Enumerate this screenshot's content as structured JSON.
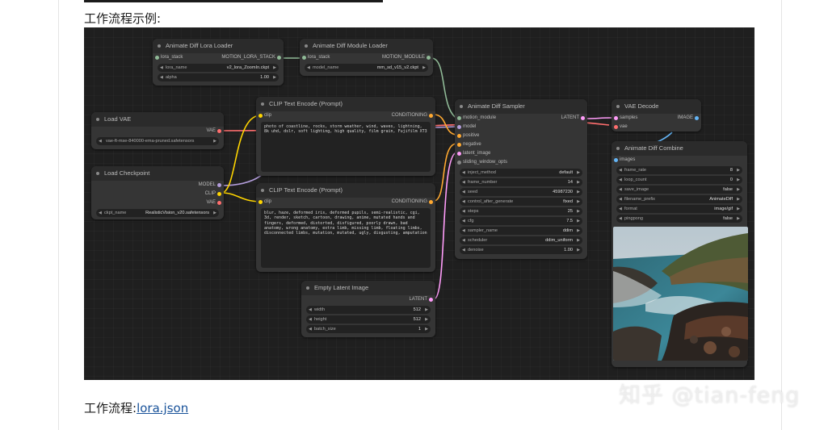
{
  "article": {
    "heading": "工作流程示例:",
    "footer_label": "工作流程:",
    "footer_link": "lora.json",
    "watermark": "知乎 @tian-feng"
  },
  "colors": {
    "model": "#b39ddb",
    "clip": "#ffd500",
    "vae": "#ff6e6e",
    "conditioning": "#ffa931",
    "latent": "#ff9cf9",
    "image": "#64b5f6",
    "motion": "#8fb996"
  },
  "nodes": {
    "lora_loader": {
      "title": "Animate Diff Lora Loader",
      "input_label": "lora_stack",
      "output_label": "MOTION_LORA_STACK",
      "widgets": [
        {
          "label": "lora_name",
          "value": "v2_lora_ZoomIn.ckpt"
        },
        {
          "label": "alpha",
          "value": "1.00"
        }
      ]
    },
    "module_loader": {
      "title": "Animate Diff Module Loader",
      "input_label": "lora_stack",
      "output_label": "MOTION_MODULE",
      "widgets": [
        {
          "label": "model_name",
          "value": "mm_sd_v15_v2.ckpt"
        }
      ]
    },
    "load_vae": {
      "title": "Load VAE",
      "output_label": "VAE",
      "widgets": [
        {
          "label": "vae_name",
          "value": "vae-ft-mse-840000-ema-pruned.safetensors"
        }
      ]
    },
    "load_checkpoint": {
      "title": "Load Checkpoint",
      "outputs": [
        "MODEL",
        "CLIP",
        "VAE"
      ],
      "widgets": [
        {
          "label": "ckpt_name",
          "value": "RealisticVision_v20.safetensors"
        }
      ]
    },
    "clip_pos": {
      "title": "CLIP Text Encode (Prompt)",
      "input_label": "clip",
      "output_label": "CONDITIONING",
      "text": "photo of coastline, rocks, storm weather, wind, waves, lightning, 8k uhd, dslr, soft lighting, high quality, film grain, Fujifilm XT3"
    },
    "clip_neg": {
      "title": "CLIP Text Encode (Prompt)",
      "input_label": "clip",
      "output_label": "CONDITIONING",
      "text": "blur, haze, deformed iris, deformed pupils, semi-realistic, cgi, 3d, render, sketch, cartoon, drawing, anime, mutated hands and fingers, deformed, distorted, disfigured, poorly drawn, bad anatomy, wrong anatomy, extra limb, missing limb, floating limbs, disconnected limbs, mutation, mutated, ugly, disgusting, amputation"
    },
    "empty_latent": {
      "title": "Empty Latent Image",
      "output_label": "LATENT",
      "widgets": [
        {
          "label": "width",
          "value": "512"
        },
        {
          "label": "height",
          "value": "512"
        },
        {
          "label": "batch_size",
          "value": "1"
        }
      ]
    },
    "sampler": {
      "title": "Animate Diff Sampler",
      "inputs": [
        "motion_module",
        "model",
        "positive",
        "negative",
        "latent_image",
        "sliding_window_opts"
      ],
      "output_label": "LATENT",
      "widgets": [
        {
          "label": "inject_method",
          "value": "default"
        },
        {
          "label": "frame_number",
          "value": "14"
        },
        {
          "label": "seed",
          "value": "45987230"
        },
        {
          "label": "control_after_generate",
          "value": "fixed"
        },
        {
          "label": "steps",
          "value": "25"
        },
        {
          "label": "cfg",
          "value": "7.5"
        },
        {
          "label": "sampler_name",
          "value": "ddim"
        },
        {
          "label": "scheduler",
          "value": "ddim_uniform"
        },
        {
          "label": "denoise",
          "value": "1.00"
        }
      ]
    },
    "vae_decode": {
      "title": "VAE Decode",
      "inputs": [
        "samples",
        "vae"
      ],
      "output_label": "IMAGE"
    },
    "combine": {
      "title": "Animate Diff Combine",
      "input_label": "images",
      "widgets": [
        {
          "label": "frame_rate",
          "value": "8"
        },
        {
          "label": "loop_count",
          "value": "0"
        },
        {
          "label": "save_image",
          "value": "false"
        },
        {
          "label": "filename_prefix",
          "value": "AnimateDiff"
        },
        {
          "label": "format",
          "value": "image/gif"
        },
        {
          "label": "pingpong",
          "value": "false"
        }
      ]
    }
  }
}
